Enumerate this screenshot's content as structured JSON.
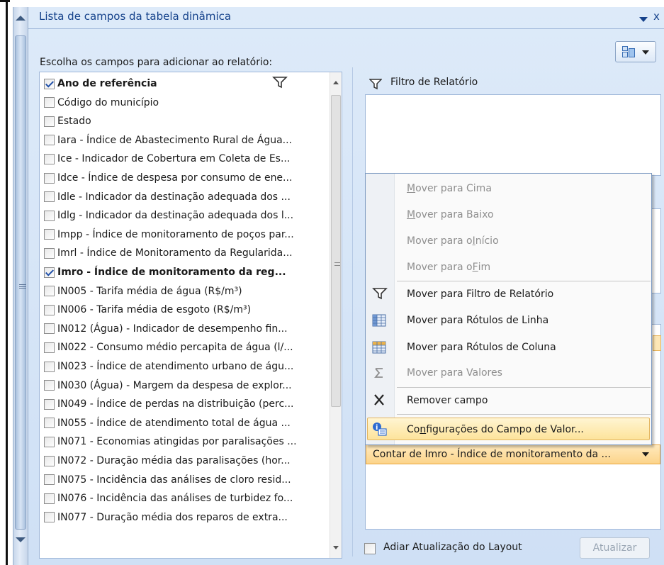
{
  "pane": {
    "title": "Lista de campos da tabela dinâmica",
    "close_glyph": "x",
    "choose_label": "Escolha os campos para adicionar ao relatório:"
  },
  "fields": [
    {
      "label": "Ano de referência",
      "checked": true,
      "bold": true
    },
    {
      "label": "Código do município",
      "checked": false
    },
    {
      "label": "Estado",
      "checked": false
    },
    {
      "label": "Iara - Índice de Abastecimento Rural de Água...",
      "checked": false
    },
    {
      "label": "Ice - Indicador de Cobertura em Coleta de Es...",
      "checked": false
    },
    {
      "label": "Idce - Índice de despesa por consumo de ene...",
      "checked": false
    },
    {
      "label": "Idle - Indicador da destinação adequada dos ...",
      "checked": false
    },
    {
      "label": "Idlg - Indicador da destinação adequada dos l...",
      "checked": false
    },
    {
      "label": "Impp - Índice de monitoramento de poços par...",
      "checked": false
    },
    {
      "label": "Imrl - Índice de Monitoramento da Regularida...",
      "checked": false
    },
    {
      "label": "Imro - Índice de monitoramento da reg...",
      "checked": true,
      "bold": true
    },
    {
      "label": "IN005 - Tarifa média de água (R$/m³)",
      "checked": false
    },
    {
      "label": "IN006 - Tarifa média de esgoto (R$/m³)",
      "checked": false
    },
    {
      "label": "IN012 (Água) - Indicador de desempenho fin...",
      "checked": false
    },
    {
      "label": "IN022 - Consumo médio percapita de água (l/...",
      "checked": false
    },
    {
      "label": "IN023 - Índice de atendimento urbano de águ...",
      "checked": false
    },
    {
      "label": "IN030 (Água) - Margem da despesa de explor...",
      "checked": false
    },
    {
      "label": "IN049 - Índice de perdas na distribuição (perc...",
      "checked": false
    },
    {
      "label": "IN055 - Índice de atendimento total de água ...",
      "checked": false
    },
    {
      "label": "IN071 - Economias atingidas por paralisações ...",
      "checked": false
    },
    {
      "label": "IN072 - Duração média das paralisações (hor...",
      "checked": false
    },
    {
      "label": "IN075 - Incidência das análises de cloro resid...",
      "checked": false
    },
    {
      "label": "IN076 - Incidência das análises de turbidez fo...",
      "checked": false
    },
    {
      "label": "IN077 - Duração média dos reparos de extra...",
      "checked": false
    }
  ],
  "areas": {
    "report_filter_label": "Filtro de Relatório",
    "values_field_label": "Contar de Imro - Índice de monitoramento da ..."
  },
  "context_menu": {
    "move_up": {
      "pre": "",
      "u": "M",
      "post": "over para Cima"
    },
    "move_down": {
      "pre": "",
      "u": "M",
      "post": "over para Baixo"
    },
    "move_start": {
      "pre": "Mover para o ",
      "u": "I",
      "post": "nício"
    },
    "move_end": {
      "pre": "Mover para o ",
      "u": "F",
      "post": "im"
    },
    "to_report_filter": "Mover para Filtro de Relatório",
    "to_row_labels": "Mover para Rótulos de Linha",
    "to_column_labels": "Mover para Rótulos de Coluna",
    "to_values": "Mover para Valores",
    "remove_field": "Remover campo",
    "value_settings": {
      "pre": "Co",
      "u": "n",
      "post": "figurações do Campo de Valor..."
    }
  },
  "footer": {
    "defer_label": "Adiar Atualização do Layout",
    "defer_checked": false,
    "update_button": "Atualizar"
  },
  "colors": {
    "title_text": "#15428b",
    "highlight": "#fde39b",
    "values_field": "#fcd48a",
    "disabled_text": "#8e8e8e"
  }
}
